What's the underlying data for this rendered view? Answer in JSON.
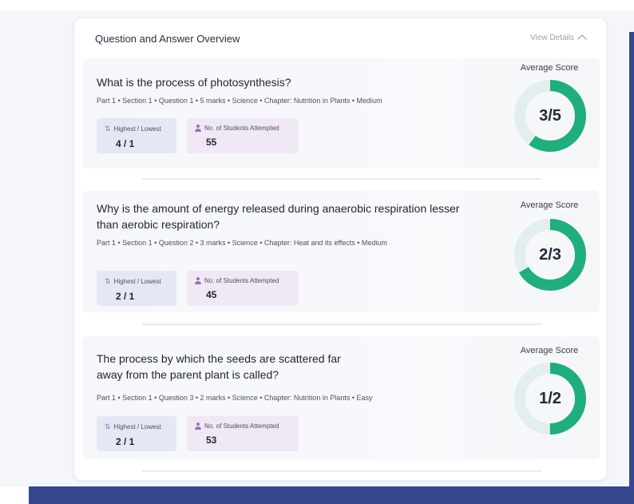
{
  "header": {
    "title": "Question and Answer Overview",
    "view_details": "View Details"
  },
  "avg_label": "Average Score",
  "stat_labels": {
    "highest_lowest": "Highest / Lowest",
    "attempted": "No. of Students Attempted"
  },
  "colors": {
    "ring_fill": "#1fae7c",
    "ring_track": "#e3efee",
    "accent_blue": "#34478f"
  },
  "questions": [
    {
      "text": "What is the process of photosynthesis?",
      "meta": "Part 1 • Section 1 • Question 1 • 5 marks • Science • Chapter: Nutrition in Plants • Medium",
      "highest_lowest": "4 / 1",
      "attempted": "55",
      "score": "3/5",
      "score_fraction": 0.6
    },
    {
      "text": "Why is the amount of energy released during anaerobic respiration lesser than aerobic respiration?",
      "meta": "Part 1 • Section 1 • Question 2 • 3 marks • Science • Chapter: Heat and its effects • Medium",
      "highest_lowest": "2 / 1",
      "attempted": "45",
      "score": "2/3",
      "score_fraction": 0.6667
    },
    {
      "text": "The process by which the seeds are scattered far away from the parent plant is called?",
      "meta": "Part 1 • Section 1 • Question 3 • 2 marks • Science • Chapter: Nutrition in Plants • Easy",
      "highest_lowest": "2 / 1",
      "attempted": "53",
      "score": "1/2",
      "score_fraction": 0.5
    }
  ]
}
